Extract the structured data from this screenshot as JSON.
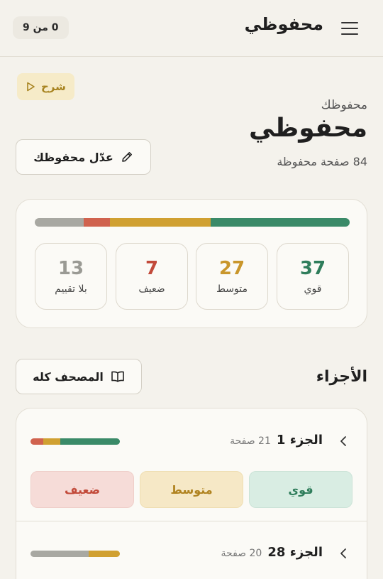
{
  "header": {
    "title": "محفوظي",
    "counter": "0 من 9",
    "menu_icon": "menu-icon"
  },
  "intro": {
    "explain_label": "شرح",
    "eyebrow": "محفوظك",
    "title": "محفوظي",
    "subtitle": "84 صفحة محفوظة",
    "edit_label": "عدّل محفوظك"
  },
  "summary": {
    "stats": [
      {
        "value": "37",
        "label": "قوي",
        "color": "#2f7d5b"
      },
      {
        "value": "27",
        "label": "متوسط",
        "color": "#c9962b"
      },
      {
        "value": "7",
        "label": "ضعيف",
        "color": "#c24a3a"
      },
      {
        "value": "13",
        "label": "بلا تقييم",
        "color": "#9a9a94"
      }
    ],
    "distribution": [
      {
        "key": "unrated",
        "count": 13,
        "color": "#a8a8a2"
      },
      {
        "key": "weak",
        "count": 7,
        "color": "#d0624e"
      },
      {
        "key": "medium",
        "count": 27,
        "color": "#d0a031"
      },
      {
        "key": "strong",
        "count": 37,
        "color": "#3a8a68"
      }
    ]
  },
  "parts": {
    "heading": "الأجزاء",
    "mushaf_label": "المصحف كله",
    "items": [
      {
        "prefix": "الجزء",
        "number": "1",
        "pages": "21 صفحة",
        "bar": [
          {
            "fraction": 0.14,
            "color": "#d0624e"
          },
          {
            "fraction": 0.19,
            "color": "#d0a031"
          },
          {
            "fraction": 0.67,
            "color": "#3a8a68"
          }
        ]
      },
      {
        "prefix": "الجزء",
        "number": "28",
        "pages": "20 صفحة",
        "bar": [
          {
            "fraction": 0.65,
            "color": "#a8a8a2"
          },
          {
            "fraction": 0.35,
            "color": "#d0a031"
          }
        ]
      }
    ],
    "rating_buttons": [
      {
        "label": "قوي",
        "bg": "#d9ede3",
        "fg": "#2f7d5b",
        "border": "#cbe3d7"
      },
      {
        "label": "متوسط",
        "bg": "#f6e8c6",
        "fg": "#b08320",
        "border": "#efdeb2"
      },
      {
        "label": "ضعيف",
        "bg": "#f6dcd8",
        "fg": "#c24a3a",
        "border": "#efcec9"
      }
    ]
  }
}
